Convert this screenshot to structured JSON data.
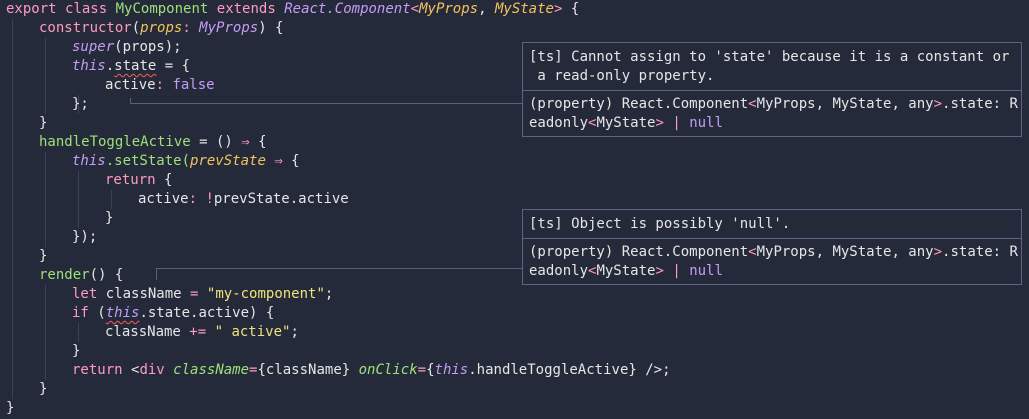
{
  "code": {
    "l1": {
      "export": "export",
      "class": "class",
      "name": "MyComponent",
      "extends": "extends",
      "base": "React.Component",
      "lt": "<",
      "p1": "MyProps",
      "comma": ", ",
      "p2": "MyState",
      "gt": ">",
      "brace": " {"
    },
    "l2": {
      "ctor": "constructor",
      "open": "(",
      "param": "props",
      "colon": ": ",
      "ptype": "MyProps",
      "close": ") {"
    },
    "l3": {
      "super": "super",
      "args": "(props);"
    },
    "l4": {
      "this": "this",
      "dot": ".",
      "state": "state",
      "rest": " = {"
    },
    "l5": {
      "prop": "active",
      "colon": ": ",
      "val": "false"
    },
    "l6": {
      "text": "};"
    },
    "l7": {
      "text": "}"
    },
    "l8": {
      "name": "handleToggleActive",
      "eq": " = () ",
      "arrow": "⇒",
      "brace": " {"
    },
    "l9": {
      "this": "this",
      "method": ".setState(",
      "param": "prevState",
      "sp": " ",
      "arrow": "⇒",
      "brace": " {"
    },
    "l10": {
      "ret": "return",
      "brace": " {"
    },
    "l11": {
      "prop": "active",
      "colon": ": ",
      "not": "!",
      "rest": "prevState.active"
    },
    "l12": {
      "text": "}"
    },
    "l13": {
      "text": "});"
    },
    "l14": {
      "text": "}"
    },
    "l15": {
      "name": "render",
      "rest": "() {"
    },
    "l16": {
      "let": "let",
      "var": " className ",
      "eq": "=",
      "sp": " ",
      "str": "\"my-component\"",
      "semi": ";"
    },
    "l17": {
      "if": "if",
      "open": " (",
      "this": "this",
      "rest": ".state.active) {"
    },
    "l18": {
      "var": "className ",
      "op": "+=",
      "sp": " ",
      "str": "\" active\"",
      "semi": ";"
    },
    "l19": {
      "text": "}"
    },
    "l20": {
      "ret": "return",
      "lt": " <",
      "tag": "div",
      "sp": " ",
      "attr1": "className",
      "eq1": "=",
      "v1": "{className}",
      "sp2": " ",
      "attr2": "onClick",
      "eq2": "=",
      "ob": "{",
      "this": "this",
      "v2": ".handleToggleActive}",
      "end": " />;"
    },
    "l21": {
      "text": "}"
    },
    "l22": {
      "text": "}"
    }
  },
  "tooltips": [
    {
      "error": "[ts] Cannot assign to 'state' because it is a constant or\n a read-only property.",
      "sig_a": "(property) React.Component",
      "sig_lt": "<",
      "sig_b": "MyProps, MyState, any",
      "sig_gt": ">",
      "sig_c": ".state: R\neadonly",
      "sig_lt2": "<",
      "sig_d": "MyState",
      "sig_gt2": ">",
      "sig_pipe": " | ",
      "sig_null": "null"
    },
    {
      "error": "[ts] Object is possibly 'null'.",
      "sig_a": "(property) React.Component",
      "sig_lt": "<",
      "sig_b": "MyProps, MyState, any",
      "sig_gt": ">",
      "sig_c": ".state: R\neadonly",
      "sig_lt2": "<",
      "sig_d": "MyState",
      "sig_gt2": ">",
      "sig_pipe": " | ",
      "sig_null": "null"
    }
  ],
  "colors": {
    "background": "#252a3a",
    "keyword": "#ff9ac1",
    "type": "#c69cf5",
    "function": "#9ee07a",
    "string": "#f2e27a",
    "parameter": "#f2c25c",
    "error_underline": "#ff5a5a"
  }
}
